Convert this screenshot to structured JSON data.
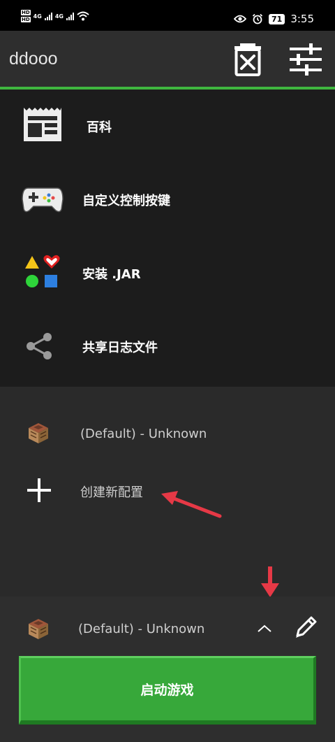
{
  "status_bar": {
    "hd1": "HD",
    "hd2": "HD",
    "net1": "4G",
    "net2": "4G",
    "battery": "71",
    "time": "3:55"
  },
  "app_bar": {
    "title": "ddooo",
    "accent_color": "#3fb63f",
    "icons": [
      "trash-x-icon",
      "tune-sliders-icon"
    ]
  },
  "menu": {
    "items": [
      {
        "label": "百科",
        "icon": "newspaper-icon"
      },
      {
        "label": "自定义控制按键",
        "icon": "gamepad-icon"
      },
      {
        "label": "安装 .JAR",
        "icon": "shapes-icon"
      },
      {
        "label": "共享日志文件",
        "icon": "share-icon"
      }
    ]
  },
  "profiles": {
    "items": [
      {
        "label": "(Default) - Unknown",
        "icon": "crafting-table-icon"
      },
      {
        "label": "创建新配置",
        "icon": "plus-icon"
      }
    ]
  },
  "bottom_bar": {
    "selected_profile": "(Default) - Unknown",
    "launch_label": "启动游戏",
    "launch_color": "#37a83a"
  },
  "annotation_color": "#e63946"
}
